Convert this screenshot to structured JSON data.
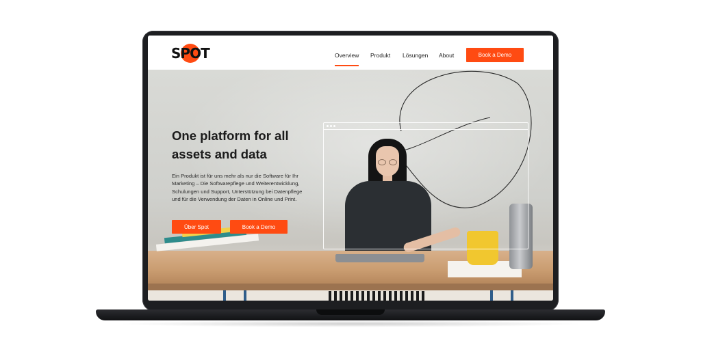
{
  "nav": {
    "logo_text": "SPOT",
    "links": [
      "Overview",
      "Produkt",
      "Lösungen",
      "About"
    ],
    "active_link": "Overview",
    "cta_label": "Book a Demo"
  },
  "hero": {
    "title": "One platform for all assets and data",
    "body": "Ein Produkt ist für uns mehr als nur die Software für Ihr Marketing – Die Softwarepflege und Weiterentwicklung, Schulungen und Support, Unterstützung bei Datenpflege und für die Verwendung der Daten in Online und Print.",
    "primary_button": "Über Spot",
    "secondary_button": "Book a Demo"
  },
  "colors": {
    "accent": "#ff4b12",
    "laptop_body": "#1d1e21",
    "text_dark": "#1b1b1b"
  },
  "icons": [
    "window-dots-icon"
  ]
}
